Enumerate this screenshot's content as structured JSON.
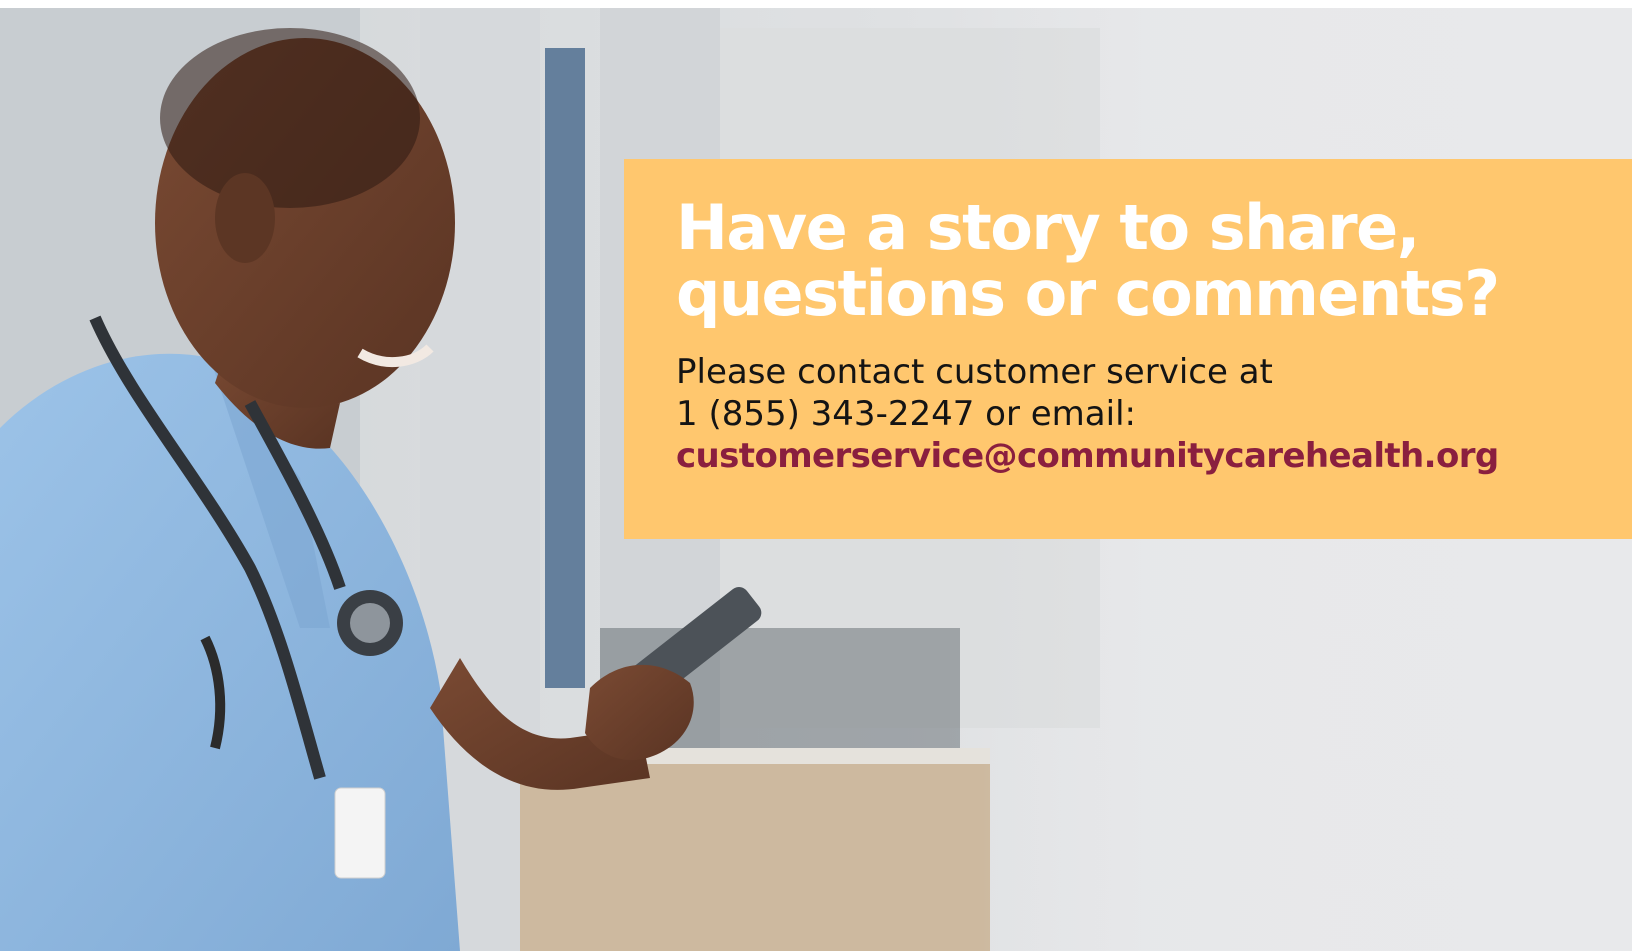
{
  "promo": {
    "headline_line1": "Have a story to share,",
    "headline_line2": "questions or comments?",
    "body_line1": "Please contact customer service at",
    "body_line2": "1 (855) 343-2247 or email:",
    "email": "customerservice@communitycarehealth.org"
  },
  "colors": {
    "card_background": "#ffc76e",
    "headline_text": "#ffffff",
    "body_text": "#141414",
    "email_link": "#8a1f3f",
    "scrubs": "#8fb8e0"
  }
}
